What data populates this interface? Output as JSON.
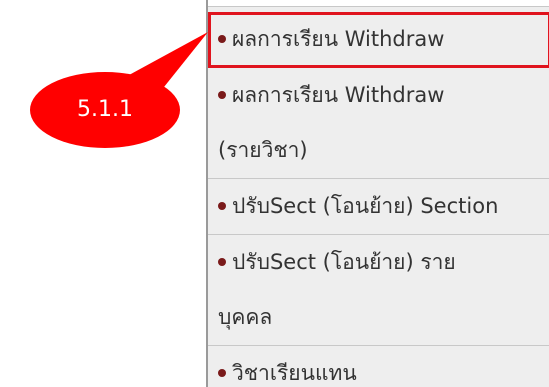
{
  "callout": {
    "label": "5.1.1",
    "color": "#ff0000"
  },
  "highlight_color": "#e0141e",
  "bullet_color": "#7a1a1a",
  "menu": {
    "items": [
      {
        "line1": "ผลการเรียน Withdraw",
        "line2": "",
        "highlighted": true
      },
      {
        "line1": "ผลการเรียน Withdraw",
        "line2": "(รายวิชา)",
        "highlighted": false
      },
      {
        "line1": "ปรับSect (โอนย้าย) Section",
        "line2": "",
        "highlighted": false
      },
      {
        "line1": "ปรับSect (โอนย้าย) ราย",
        "line2": "บุคคล",
        "highlighted": false
      },
      {
        "line1": "วิชาเรียนแทน",
        "line2": "",
        "highlighted": false
      }
    ]
  }
}
